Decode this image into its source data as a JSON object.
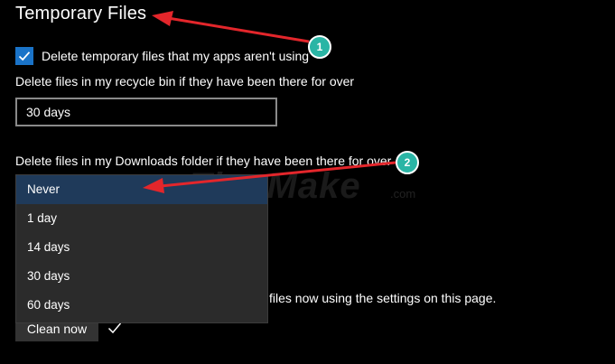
{
  "header": {
    "title": "Temporary Files"
  },
  "temp_files": {
    "checkbox_label": "Delete temporary files that my apps aren't using",
    "checked": true
  },
  "recycle_bin": {
    "label": "Delete files in my recycle bin if they have been there for over",
    "selected_value": "30 days"
  },
  "downloads": {
    "label": "Delete files in my Downloads folder if they have been there for over",
    "options": [
      "Never",
      "1 day",
      "14 days",
      "30 days",
      "60 days"
    ],
    "selected_index": 0
  },
  "clean": {
    "description": "files now using the settings on this page.",
    "button_label": "Clean now"
  },
  "annotations": {
    "badge_1": "1",
    "badge_2": "2"
  },
  "watermark": {
    "text": "TipsMake",
    "suffix": ".com"
  },
  "colors": {
    "background": "#000000",
    "checkbox_accent": "#1a73c8",
    "dropdown_bg": "#2b2b2b",
    "selected_option_bg": "#1f3a5a",
    "annotation_arrow": "#e3262b",
    "badge_fill": "#2ab5a5"
  }
}
